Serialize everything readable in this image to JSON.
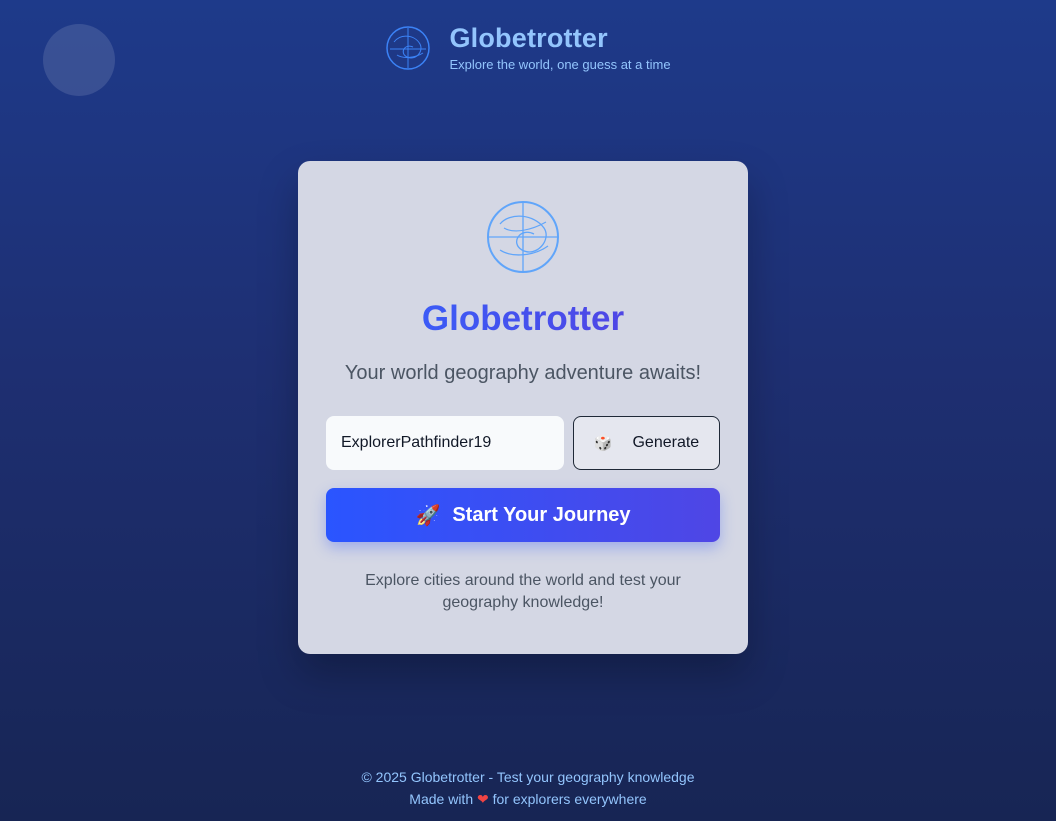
{
  "header": {
    "title": "Globetrotter",
    "subtitle": "Explore the world, one guess at a time",
    "logo_icon": "globe-icon"
  },
  "card": {
    "icon": "globe-icon",
    "title": "Globetrotter",
    "tagline": "Your world geography adventure awaits!",
    "username_value": "ExplorerPathfinder19",
    "generate_icon": "dice-icon",
    "generate_label": "Generate",
    "start_icon": "rocket-icon",
    "start_label": "Start Your Journey",
    "description": "Explore cities around the world and test your geography knowledge!"
  },
  "footer": {
    "copyright": "© 2025 Globetrotter - Test your geography knowledge",
    "made_prefix": "Made with",
    "made_suffix": "for explorers everywhere",
    "heart_icon": "heart-icon"
  },
  "colors": {
    "background": "#1e3a8a",
    "accent": "#3b5bf6",
    "header_text": "#93c5fd"
  }
}
